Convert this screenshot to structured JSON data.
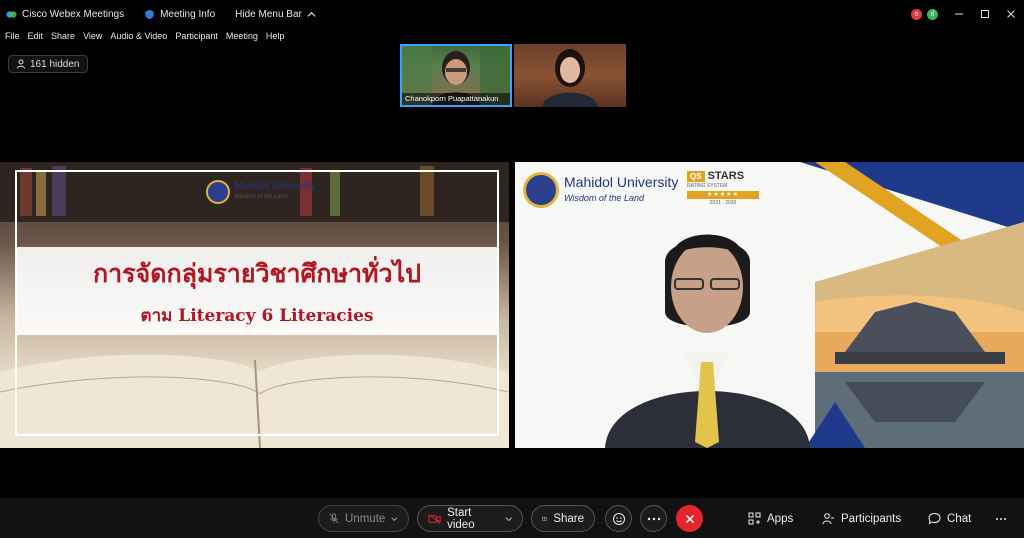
{
  "titlebar": {
    "app_title": "Cisco Webex Meetings",
    "meeting_info": "Meeting Info",
    "hide_menu": "Hide Menu Bar",
    "status_red": "o",
    "status_green": "ıl"
  },
  "menu": [
    "File",
    "Edit",
    "Share",
    "View",
    "Audio & Video",
    "Participant",
    "Meeting",
    "Help"
  ],
  "hidden_count": "161 hidden",
  "thumbnails": [
    {
      "name": "Chanokporn Puapattanakun"
    }
  ],
  "slide": {
    "logo_name": "Mahidol University",
    "logo_tagline": "Wisdom of the Land",
    "title": "การจัดกลุ่มรายวิชาศึกษาทั่วไป",
    "subtitle": "ตาม Literacy 6 Literacies"
  },
  "camera": {
    "logo_name": "Mahidol University",
    "logo_tagline": "Wisdom of the Land",
    "qs_box": "QS",
    "qs_stars": "STARS",
    "qs_sub": "RATING SYSTEM",
    "qs_bar": "★★★★★",
    "qs_year": "2021 - 2026"
  },
  "controls": {
    "unmute": "Unmute",
    "start_video": "Start video",
    "share": "Share",
    "apps": "Apps",
    "participants": "Participants",
    "chat": "Chat"
  },
  "colors": {
    "accent_blue": "#3ba0ff",
    "end_red": "#e3262c",
    "slide_red": "#b01722",
    "mahidol_blue": "#24348a",
    "gold": "#e2a323"
  }
}
